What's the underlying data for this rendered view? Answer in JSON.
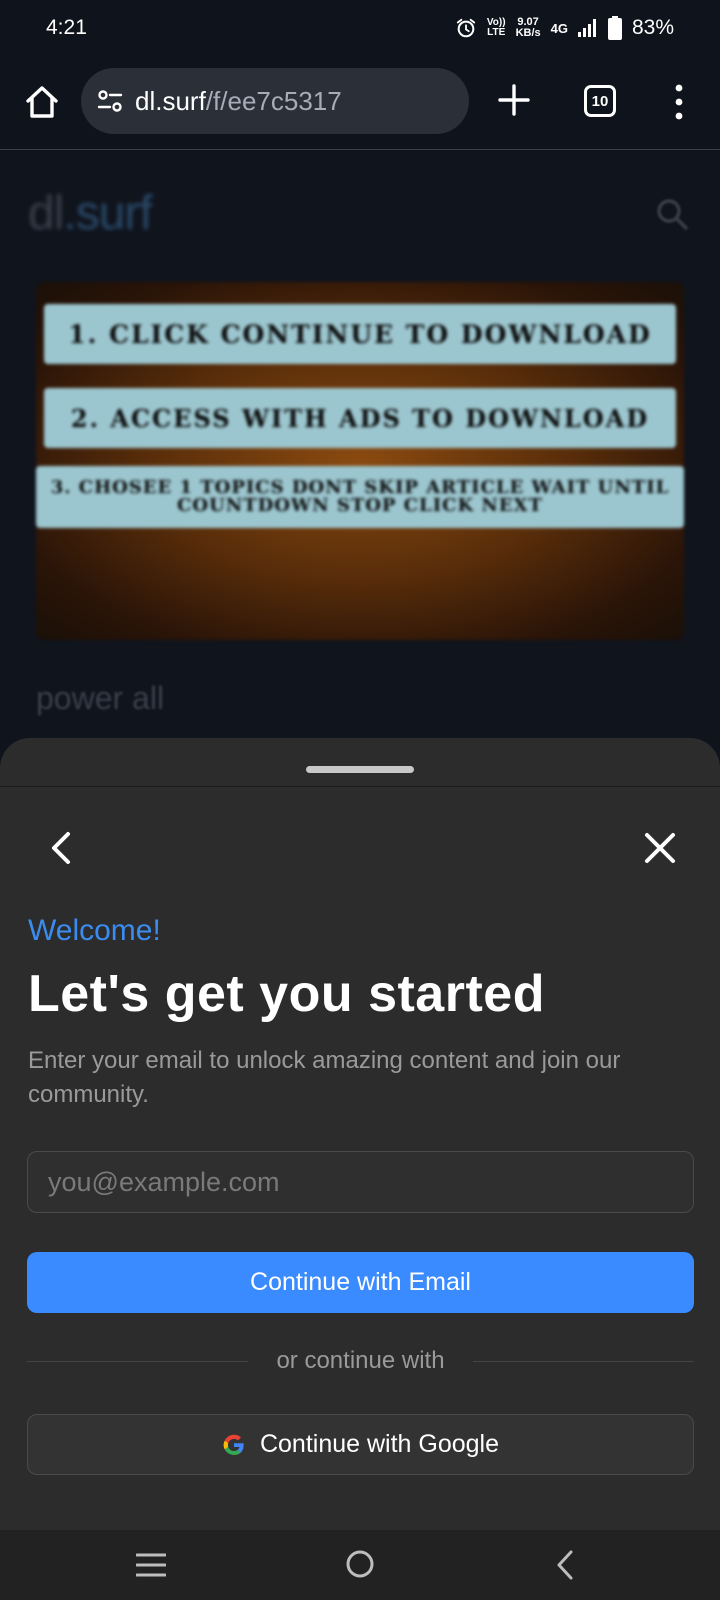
{
  "status_bar": {
    "time": "4:21",
    "volte_line1": "Vo))",
    "volte_line2": "LTE",
    "speed_value": "9.07",
    "speed_unit": "KB/s",
    "network": "4G",
    "battery": "83%"
  },
  "browser": {
    "url_host": "dl.surf",
    "url_path": "/f/ee7c5317",
    "tab_count": "10"
  },
  "page": {
    "site_name": "dl",
    "site_tld": ".surf",
    "banner_lines": [
      "1. Click Continue to Download",
      "2. Access with ads to Download",
      "3. chosee 1 topics dont skip article wait until countdown stop click next"
    ],
    "subtitle": "power all"
  },
  "sheet": {
    "welcome": "Welcome!",
    "headline": "Let's get you started",
    "subtext": "Enter your email to unlock amazing content and join our community.",
    "email_placeholder": "you@example.com",
    "email_button": "Continue with Email",
    "divider": "or continue with",
    "google_button": "Continue with Google"
  },
  "colors": {
    "accent": "#3a8bff",
    "welcome": "#3b8cf0",
    "sheet_bg": "#2c2c2c"
  },
  "icons": {
    "home": "home-icon",
    "site_settings": "tune-icon",
    "new_tab": "plus-icon",
    "menu": "more-vert-icon",
    "search": "search-icon",
    "back": "chevron-left-icon",
    "close": "close-icon",
    "google": "google-icon"
  }
}
